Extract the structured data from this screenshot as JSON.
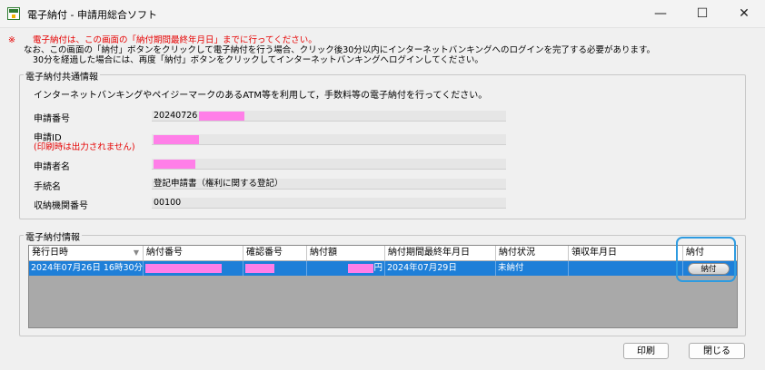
{
  "window": {
    "title": "電子納付 - 申請用総合ソフト",
    "minimize_glyph": "—",
    "maximize_glyph": "☐",
    "close_glyph": "✕"
  },
  "notice": {
    "mark": "※",
    "line1": "電子納付は、この画面の「納付期間最終年月日」までに行ってください。",
    "line2": "なお、この画面の「納付」ボタンをクリックして電子納付を行う場合、クリック後30分以内にインターネットバンキングへのログインを完了する必要があります。",
    "line3": "30分を経過した場合には、再度「納付」ボタンをクリックしてインターネットバンキングへログインしてください。"
  },
  "common_info": {
    "title": "電子納付共通情報",
    "description": "インターネットバンキングやペイジーマークのあるATM等を利用して，手数料等の電子納付を行ってください。",
    "fields": [
      {
        "label": "申請番号",
        "value": "20240726"
      },
      {
        "label": "申請ID",
        "sublabel": "(印刷時は出力されません)",
        "value": ""
      },
      {
        "label": "申請者名",
        "value": ""
      },
      {
        "label": "手続名",
        "value": "登記申請書（権利に関する登記）"
      },
      {
        "label": "収納機関番号",
        "value": "00100"
      }
    ]
  },
  "payment_info": {
    "title": "電子納付情報",
    "columns": [
      "発行日時",
      "納付番号",
      "確認番号",
      "納付額",
      "納付期間最終年月日",
      "納付状況",
      "領収年月日",
      "納付"
    ],
    "row": {
      "issued": "2024年07月26日 16時30分",
      "payment_no": "",
      "confirm_no": "",
      "amount_suffix": "円",
      "deadline": "2024年07月29日",
      "status": "未納付",
      "received": "",
      "pay_button": "納付"
    }
  },
  "footer": {
    "print_label": "印刷",
    "close_label": "閉じる"
  },
  "colors": {
    "accent_blue": "#1e7fd8",
    "warning_red": "#e60000",
    "redaction": "#ff7fe8"
  }
}
